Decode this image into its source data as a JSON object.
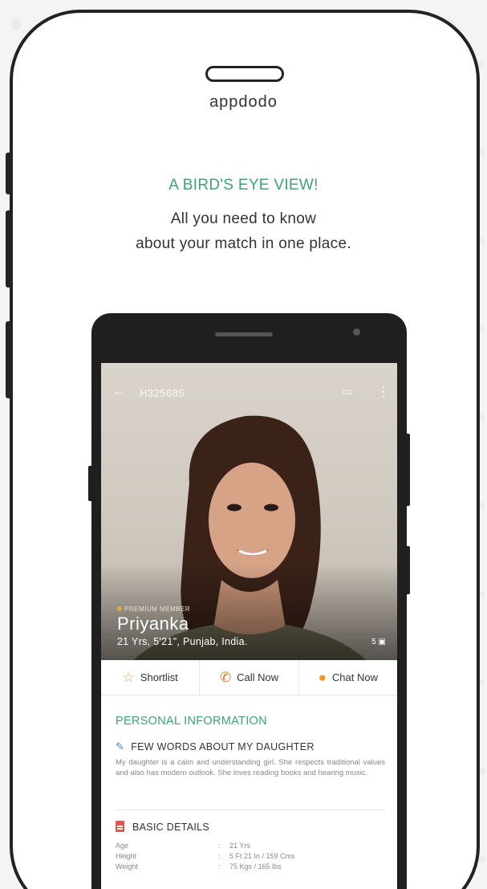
{
  "brand": "appdodo",
  "headline": "A BIRD'S EYE VIEW!",
  "subline": [
    "All you need to know",
    "about your match in one place."
  ],
  "profile": {
    "id": "H325685",
    "badge": "PREMIUM MEMBER",
    "name": "Priyanka",
    "meta": "21 Yrs, 5'21\", Punjab, India.",
    "photo_count": "5"
  },
  "actions": [
    {
      "label": "Shortlist",
      "icon": "star-icon"
    },
    {
      "label": "Call Now",
      "icon": "phone-icon"
    },
    {
      "label": "Chat Now",
      "icon": "chat-bubble-icon"
    }
  ],
  "sections": {
    "personal_title": "PERSONAL INFORMATION",
    "about_title": "FEW WORDS ABOUT MY DAUGHTER",
    "about_text": "My daughter is a calm and understanding girl. She respects traditional values and also has modern outlook. She loves reading books and hearing music.",
    "basic_title": "BASIC DETAILS"
  },
  "details": [
    {
      "label": "Age",
      "value": "21 Yrs"
    },
    {
      "label": "Height",
      "value": "5 Ft 21 In / 159 Cms"
    },
    {
      "label": "Weight",
      "value": "75 Kgs / 165 lbs"
    }
  ],
  "colors": {
    "accent": "#3aa37a",
    "frame": "#232323",
    "call": "#e8731a",
    "chat": "#f39a1e",
    "star": "#e8a93a"
  }
}
